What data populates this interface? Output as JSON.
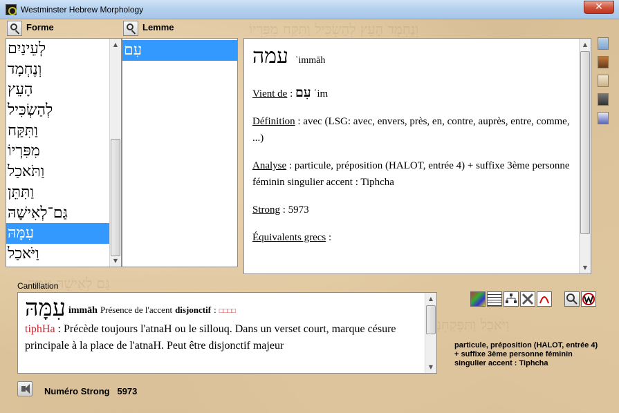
{
  "window": {
    "title": "Westminster Hebrew Morphology",
    "close": "✕"
  },
  "columns": {
    "forme": "Forme",
    "lemme": "Lemme"
  },
  "forme_list": [
    "לְעֵינַיִם",
    "וְנֶחְמָד",
    "הָעֵץ",
    "לְהַשְׂכִּיל",
    "וַתִּקַּח",
    "מִפִּרְיוֹ",
    "וַתֹּאכַל",
    "וַתִּתֵּן",
    "גַּם־לְאִישָׁהּ",
    "עִמָּהּ",
    "וַיֹּאכַל"
  ],
  "lemme_list": [
    "עִם"
  ],
  "detail": {
    "word": "עמה",
    "translit": "ʿimmāh",
    "vient_de_label": "Vient de",
    "vient_de_word": "עִם",
    "vient_de_translit": "ʿim",
    "definition_label": "Définition",
    "definition_text": " : avec (LSG: avec, envers, près, en, contre, auprès, entre, comme, ...)",
    "analyse_label": "Analyse",
    "analyse_text": " : particule, préposition (HALOT, entrée 4) + suffixe 3ème personne féminin singulier accent : Tiphcha",
    "strong_label": "Strong",
    "strong_text": " : 5973",
    "equivalents_label": "Équivalents grecs",
    "equivalents_text": " :"
  },
  "cantillation": {
    "label": "Cantillation",
    "word": "עִמָּהּ",
    "translit": "immāh",
    "presence_text": "Présence de l'accent",
    "disjonctif": "disjonctif",
    "colon": ":",
    "marks": "□□□□",
    "accent_name": "tiphHa",
    "accent_text": " : Précède toujours l'atnaH ou le sillouq. Dans un verset court, marque césure principale à la place de l'atnaH. Peut être disjonctif majeur"
  },
  "summary": "particule, préposition      (HALOT, entrée 4)  + suffixe  3ème personne féminin singulier  accent : Tiphcha",
  "footer": {
    "strong_label": "Numéro Strong",
    "strong_value": "5973"
  }
}
